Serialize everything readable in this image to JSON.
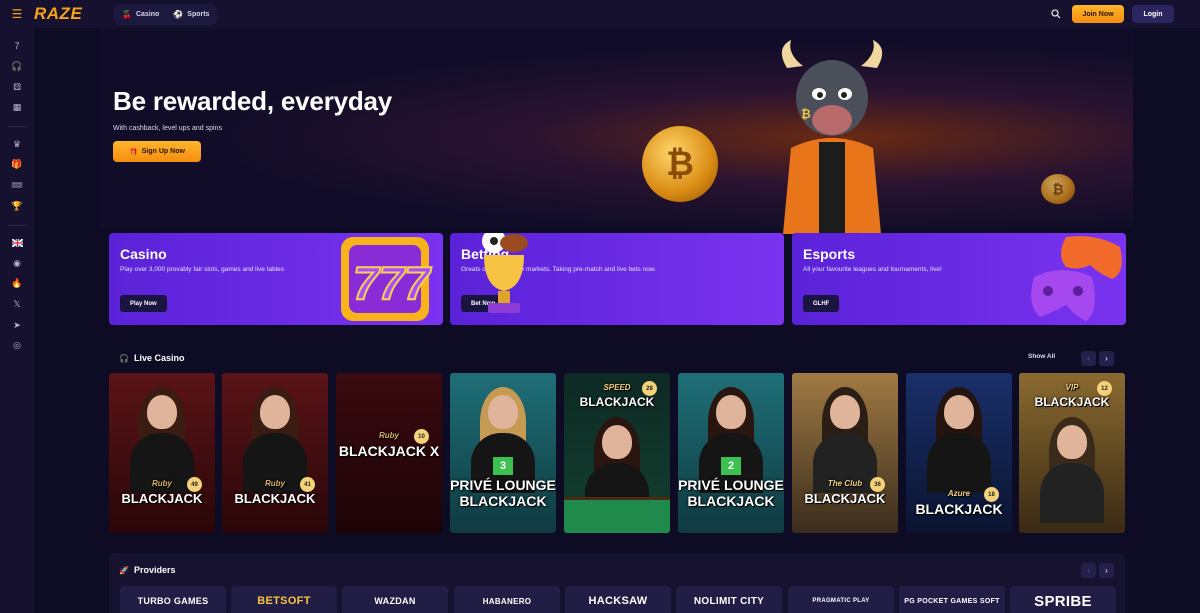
{
  "brand": {
    "logo": "RAZE",
    "accent": "#f7a21b"
  },
  "header": {
    "tabs": [
      {
        "label": "Casino",
        "icon": "cherries-icon"
      },
      {
        "label": "Sports",
        "icon": "soccer-ball-icon"
      }
    ],
    "join_label": "Join Now",
    "login_label": "Login"
  },
  "sidebar": {
    "icons": [
      "slots-777-icon",
      "headset-icon",
      "dice-icon",
      "slot-machine-icon",
      "crown-icon",
      "gift-icon",
      "ticket-icon",
      "trophy-icon",
      "uk-flag-icon",
      "discord-icon",
      "fire-icon",
      "x-logo-icon",
      "telegram-icon",
      "instagram-icon"
    ]
  },
  "hero": {
    "title": "Be rewarded, everyday",
    "subtitle": "With cashback, level ups and spins",
    "cta": "Sign Up Now"
  },
  "promos": [
    {
      "title": "Casino",
      "desc": "Play over 3,000 provably fair slots, games and live tables",
      "button": "Play Now"
    },
    {
      "title": "Betting",
      "desc": "Greats odds and wide markets. Taking pre-match and live bets now.",
      "button": "Bet Now"
    },
    {
      "title": "Esports",
      "desc": "All your favourite leagues and tournaments, live!",
      "button": "GLHF"
    }
  ],
  "live_casino": {
    "title": "Live Casino",
    "show_all": "Show All",
    "games": [
      {
        "line1": "Ruby",
        "line2": "BLACKJACK",
        "badge": "49"
      },
      {
        "line1": "Ruby",
        "line2": "BLACKJACK",
        "badge": "41"
      },
      {
        "line1": "Ruby",
        "line2": "BLACKJACK X",
        "badge": "10"
      },
      {
        "line1": "PRIVÉ LOUNGE",
        "line2": "BLACKJACK",
        "badge": "3"
      },
      {
        "line1": "SPEED",
        "line2": "BLACKJACK",
        "badge": "28"
      },
      {
        "line1": "PRIVÉ LOUNGE",
        "line2": "BLACKJACK",
        "badge": "2"
      },
      {
        "line1": "The Club",
        "line2": "BLACKJACK",
        "badge": "36"
      },
      {
        "line1": "Azure",
        "line2": "BLACKJACK",
        "badge": "18"
      },
      {
        "line1": "VIP",
        "line2": "BLACKJACK",
        "badge": "12"
      }
    ]
  },
  "providers": {
    "title": "Providers",
    "items": [
      "TURBO GAMES",
      "BETSOFT",
      "WAZDAN",
      "HABANERO",
      "HACKSAW",
      "NOLIMIT CITY",
      "PRAGMATIC PLAY",
      "PG POCKET GAMES SOFT",
      "SPRIBE"
    ]
  }
}
